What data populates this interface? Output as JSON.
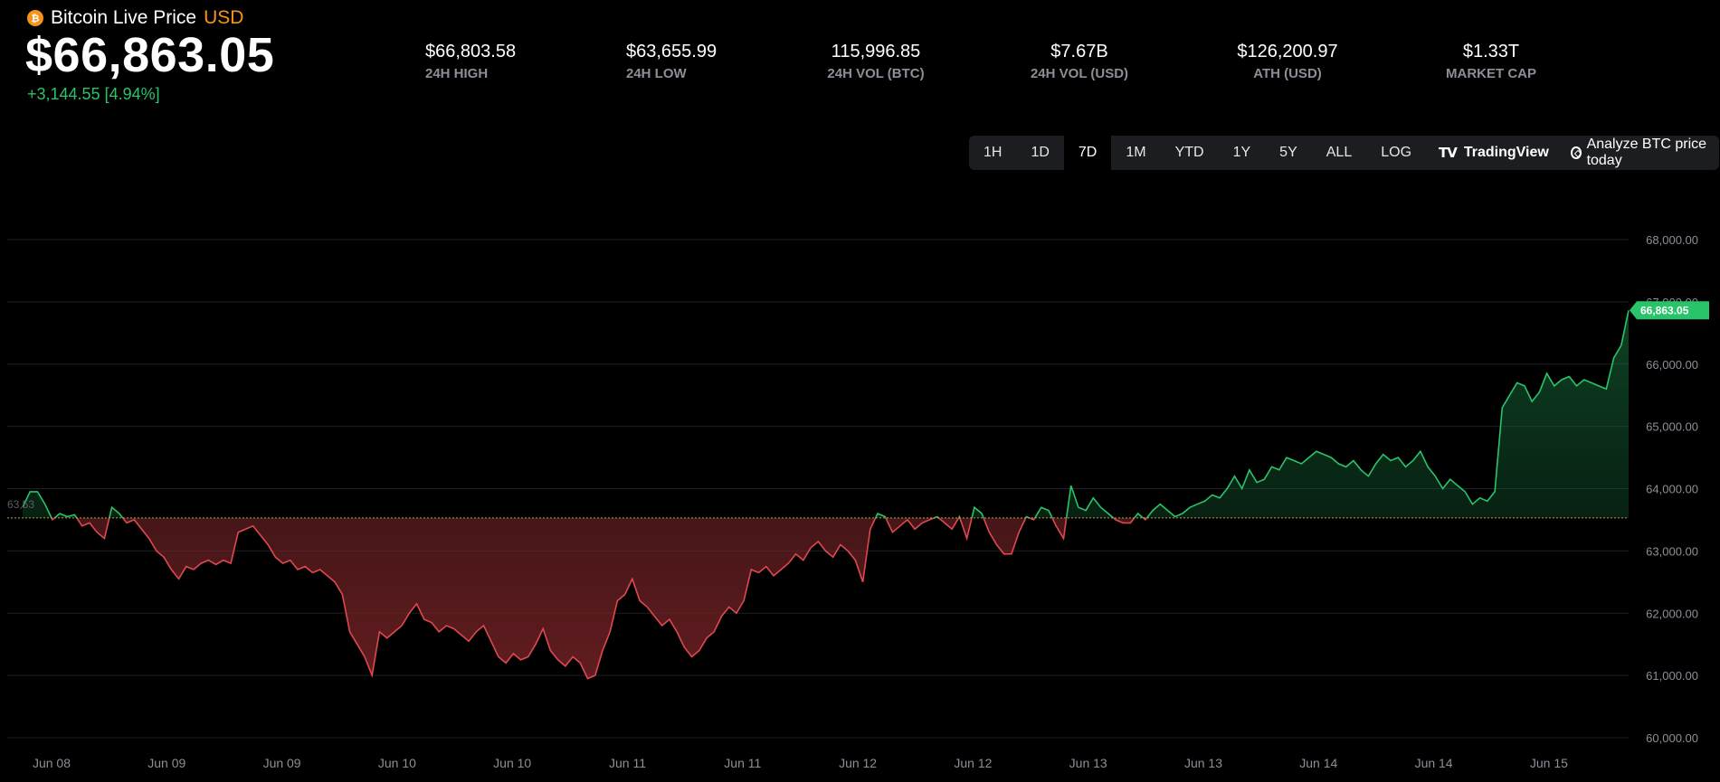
{
  "header": {
    "title": "Bitcoin Live Price",
    "currency": "USD",
    "coin_glyph": "₿",
    "price": "$66,863.05",
    "change": "+3,144.55 [4.94%]"
  },
  "stats": [
    {
      "value": "$66,803.58",
      "label": "24H HIGH"
    },
    {
      "value": "$63,655.99",
      "label": "24H LOW"
    },
    {
      "value": "115,996.85",
      "label": "24H VOL (BTC)"
    },
    {
      "value": "$7.67B",
      "label": "24H VOL (USD)"
    },
    {
      "value": "$126,200.97",
      "label": "ATH (USD)"
    },
    {
      "value": "$1.33T",
      "label": "MARKET CAP"
    }
  ],
  "range_buttons": [
    "1H",
    "1D",
    "7D",
    "1M",
    "YTD",
    "1Y",
    "5Y",
    "ALL",
    "LOG"
  ],
  "active_range": "7D",
  "tradingview_label": "TradingView",
  "tradingview_glyph": "TV",
  "analyze_label": "Analyze BTC price today",
  "colors": {
    "up": "#29c46a",
    "down": "#e0484f",
    "accent_currency": "#f7931a",
    "grid": "#1e1f23",
    "axis_text": "#8b8f97"
  },
  "chart_data": {
    "type": "area",
    "title": "",
    "xlabel": "",
    "ylabel": "",
    "ylim": [
      60000,
      68000
    ],
    "yticks": [
      "60,000.00",
      "61,000.00",
      "62,000.00",
      "63,000.00",
      "64,000.00",
      "65,000.00",
      "66,000.00",
      "67,000.00",
      "68,000.00"
    ],
    "xticks": [
      "Jun 08",
      "Jun 09",
      "Jun 09",
      "Jun 10",
      "Jun 10",
      "Jun 11",
      "Jun 11",
      "Jun 12",
      "Jun 12",
      "Jun 13",
      "Jun 13",
      "Jun 14",
      "Jun 14",
      "Jun 15"
    ],
    "baseline": 63530,
    "baseline_label": "63,53",
    "last_price_label": "66,863.05",
    "grid": true,
    "series": [
      {
        "values": [
          63700,
          63950,
          63950,
          63750,
          63500,
          63600,
          63550,
          63580,
          63400,
          63450,
          63300,
          63200,
          63700,
          63600,
          63450,
          63500,
          63350,
          63200,
          63000,
          62900,
          62700,
          62550,
          62750,
          62700,
          62800,
          62850,
          62780,
          62850,
          62800,
          63300,
          63350,
          63400,
          63250,
          63100,
          62900,
          62800,
          62850,
          62700,
          62750,
          62650,
          62700,
          62600,
          62500,
          62300,
          61700,
          61500,
          61300,
          61000,
          61700,
          61600,
          61700,
          61800,
          62000,
          62150,
          61900,
          61850,
          61700,
          61800,
          61750,
          61650,
          61550,
          61700,
          61800,
          61550,
          61300,
          61200,
          61350,
          61250,
          61300,
          61500,
          61750,
          61400,
          61250,
          61150,
          61300,
          61200,
          60950,
          61000,
          61400,
          61700,
          62200,
          62300,
          62550,
          62200,
          62100,
          61950,
          61800,
          61900,
          61700,
          61450,
          61300,
          61400,
          61600,
          61700,
          61950,
          62100,
          62000,
          62200,
          62700,
          62650,
          62750,
          62600,
          62700,
          62800,
          62950,
          62850,
          63050,
          63150,
          63000,
          62900,
          63100,
          63000,
          62850,
          62500,
          63350,
          63600,
          63550,
          63300,
          63400,
          63500,
          63350,
          63450,
          63500,
          63550,
          63450,
          63350,
          63550,
          63200,
          63700,
          63600,
          63300,
          63100,
          62950,
          62950,
          63300,
          63550,
          63500,
          63700,
          63650,
          63400,
          63200,
          64050,
          63700,
          63650,
          63850,
          63700,
          63600,
          63500,
          63450,
          63450,
          63600,
          63500,
          63650,
          63750,
          63650,
          63550,
          63600,
          63700,
          63750,
          63800,
          63900,
          63850,
          64000,
          64200,
          64000,
          64300,
          64100,
          64150,
          64350,
          64300,
          64500,
          64450,
          64400,
          64500,
          64600,
          64550,
          64500,
          64400,
          64350,
          64450,
          64300,
          64200,
          64400,
          64550,
          64450,
          64500,
          64350,
          64450,
          64600,
          64350,
          64200,
          64000,
          64150,
          64050,
          63950,
          63750,
          63850,
          63800,
          63950,
          65300,
          65500,
          65700,
          65650,
          65400,
          65550,
          65850,
          65650,
          65750,
          65800,
          65650,
          65750,
          65700,
          65650,
          65600,
          66100,
          66300,
          66863.05
        ]
      }
    ]
  }
}
